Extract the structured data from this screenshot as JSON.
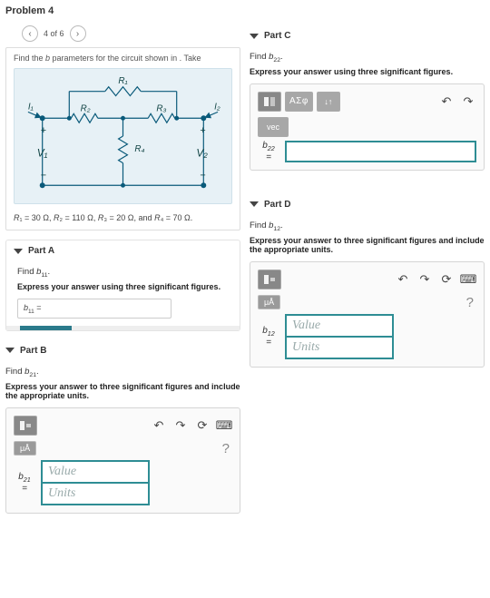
{
  "problem": {
    "title": "Problem 4",
    "pager": "4 of 6"
  },
  "intro": {
    "text_before": "Find the ",
    "param": "b",
    "text_after": " parameters for the circuit shown in . Take",
    "givensPrefix": "R",
    "givens": "R₁ = 30 Ω, R₂ = 110 Ω, R₃ = 20 Ω, and R₄ = 70 Ω."
  },
  "circuit": {
    "R1": "R₁",
    "R2": "R₂",
    "R3": "R₃",
    "R4": "R₄",
    "I1": "I₁",
    "I2": "I₂",
    "V1": "V₁",
    "V2": "V₂"
  },
  "partA": {
    "title": "Part A",
    "find": "Find b₁₁.",
    "instr": "Express your answer using three significant figures.",
    "lhs": "b₁₁ ="
  },
  "partB": {
    "title": "Part B",
    "find": "Find b₂₁.",
    "instr": "Express your answer to three significant figures and include the appropriate units.",
    "lhs_top": "b₂₁",
    "lhs_bot": "=",
    "valuePlaceholder": "Value",
    "unitsPlaceholder": "Units",
    "unitChip": "μÅ"
  },
  "partC": {
    "title": "Part C",
    "find": "Find b₂₂.",
    "instr": "Express your answer using three significant figures.",
    "lhs_top": "b₂₂",
    "lhs_bot": "=",
    "t_sigma": "ΑΣφ",
    "t_arrows": "↓↑",
    "t_vec": "vec"
  },
  "partD": {
    "title": "Part D",
    "find": "Find b₁₂.",
    "instr": "Express your answer to three significant figures and include the appropriate units.",
    "lhs_top": "b₁₂",
    "lhs_bot": "=",
    "valuePlaceholder": "Value",
    "unitsPlaceholder": "Units",
    "unitChip": "μÅ"
  },
  "icons": {
    "undo": "↶",
    "redo": "↷",
    "reset": "⟳",
    "keyboard": "⌨",
    "help": "?"
  }
}
